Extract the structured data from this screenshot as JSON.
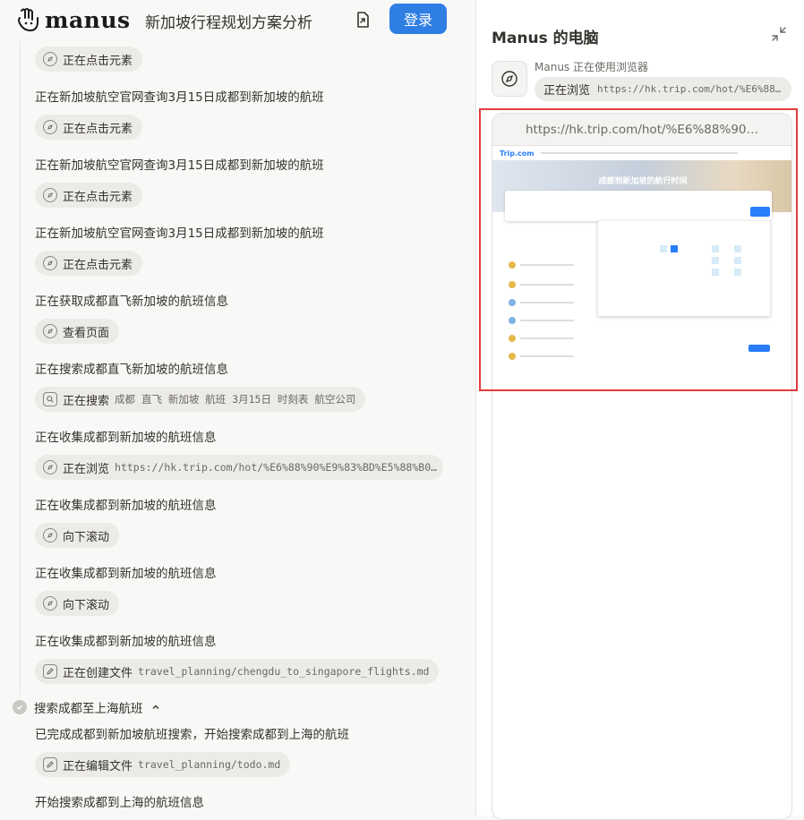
{
  "header": {
    "logo_text": "manus",
    "title": "新加坡行程规划方案分析",
    "login_label": "登录"
  },
  "feed": {
    "chip_click": "正在点击元素",
    "line_query": "正在新加坡航空官网查询3月15日成都到新加坡的航班",
    "line_get": "正在获取成都直飞新加坡的航班信息",
    "chip_view": "查看页面",
    "line_search": "正在搜索成都直飞新加坡的航班信息",
    "chip_search_label": "正在搜索",
    "chip_search_arg": "成都 直飞 新加坡 航班 3月15日 时刻表 航空公司",
    "line_collect": "正在收集成都到新加坡的航班信息",
    "chip_browse_label": "正在浏览",
    "chip_browse_arg": "https://hk.trip.com/hot/%E6%88%90%E9%83%BD%E5%88%B0…",
    "chip_scroll": "向下滚动",
    "chip_create_label": "正在创建文件",
    "chip_create_arg": "travel_planning/chengdu_to_singapore_flights.md",
    "step_title": "搜索成都至上海航班",
    "line_done": "已完成成都到新加坡航班搜索，开始搜索成都到上海的航班",
    "chip_edit_label": "正在编辑文件",
    "chip_edit_arg": "travel_planning/todo.md",
    "line_start": "开始搜索成都到上海的航班信息"
  },
  "panel": {
    "title": "Manus 的电脑",
    "using_text": "Manus 正在使用浏览器",
    "url_label": "正在浏览",
    "url_value": "https://hk.trip.com/hot/%E6%88…",
    "browser_url": "https://hk.trip.com/hot/%E6%88%90…",
    "site_brand": "Trip.com",
    "hero_title": "成都到新加坡的航行时间"
  },
  "colors": {
    "accent": "#2f7ee4",
    "highlight_border": "#e43b3b"
  }
}
